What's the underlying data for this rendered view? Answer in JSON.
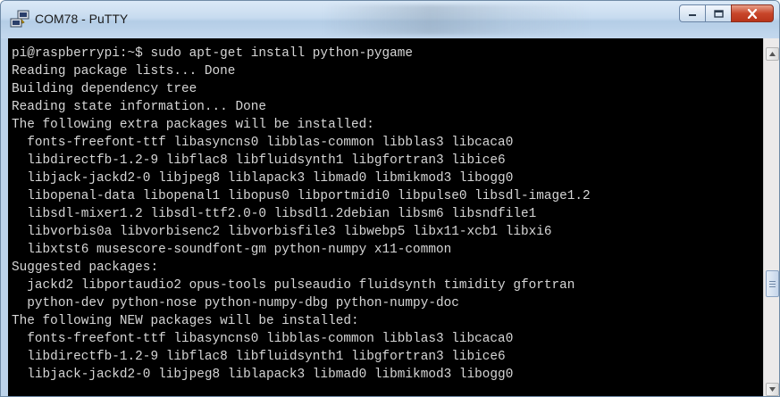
{
  "window": {
    "title": "COM78 - PuTTY",
    "icon": "putty-icon",
    "controls": [
      "minimize-icon",
      "maximize-icon",
      "close-icon"
    ]
  },
  "terminal": {
    "foreground": "#d6d6d6",
    "background": "#000000",
    "lines": [
      "pi@raspberrypi:~$ sudo apt-get install python-pygame",
      "Reading package lists... Done",
      "Building dependency tree",
      "Reading state information... Done",
      "The following extra packages will be installed:",
      "  fonts-freefont-ttf libasyncns0 libblas-common libblas3 libcaca0",
      "  libdirectfb-1.2-9 libflac8 libfluidsynth1 libgfortran3 libice6",
      "  libjack-jackd2-0 libjpeg8 liblapack3 libmad0 libmikmod3 libogg0",
      "  libopenal-data libopenal1 libopus0 libportmidi0 libpulse0 libsdl-image1.2",
      "  libsdl-mixer1.2 libsdl-ttf2.0-0 libsdl1.2debian libsm6 libsndfile1",
      "  libvorbis0a libvorbisenc2 libvorbisfile3 libwebp5 libx11-xcb1 libxi6",
      "  libxtst6 musescore-soundfont-gm python-numpy x11-common",
      "Suggested packages:",
      "  jackd2 libportaudio2 opus-tools pulseaudio fluidsynth timidity gfortran",
      "  python-dev python-nose python-numpy-dbg python-numpy-doc",
      "The following NEW packages will be installed:",
      "  fonts-freefont-ttf libasyncns0 libblas-common libblas3 libcaca0",
      "  libdirectfb-1.2-9 libflac8 libfluidsynth1 libgfortran3 libice6",
      "  libjack-jackd2-0 libjpeg8 liblapack3 libmad0 libmikmod3 libogg0"
    ]
  },
  "scrollbar": {
    "up_icon": "scroll-up-arrow-icon",
    "down_icon": "scroll-down-arrow-icon"
  }
}
